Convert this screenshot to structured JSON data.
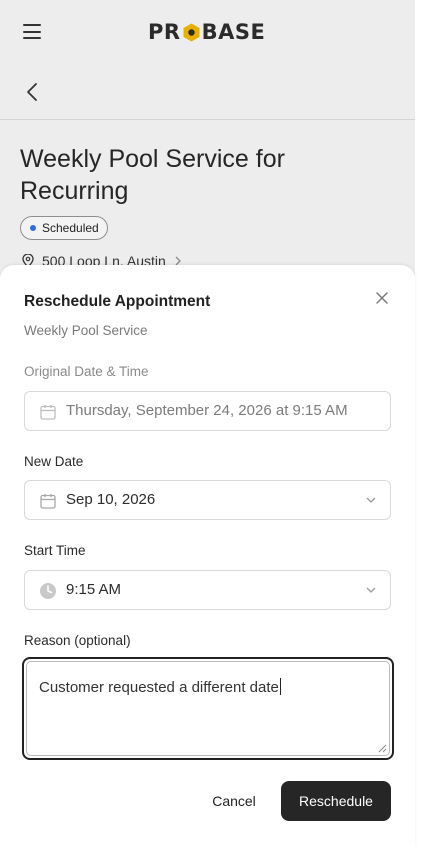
{
  "app": {
    "logo_text_left": "PR",
    "logo_text_right": "BASE"
  },
  "background": {
    "title": "Weekly Pool Service for Recurring",
    "status_badge": "Scheduled",
    "address": "500 Loop Ln, Austin"
  },
  "modal": {
    "title": "Reschedule Appointment",
    "subtitle": "Weekly Pool Service",
    "original": {
      "label": "Original Date & Time",
      "value": "Thursday, September 24, 2026 at 9:15 AM"
    },
    "new_date": {
      "label": "New Date",
      "value": "Sep 10, 2026"
    },
    "start_time": {
      "label": "Start Time",
      "value": "9:15 AM"
    },
    "reason": {
      "label": "Reason (optional)",
      "value": "Customer requested a different date"
    },
    "cancel_label": "Cancel",
    "submit_label": "Reschedule"
  },
  "colors": {
    "brand_dark": "#262626",
    "logo_accent": "#e8b100",
    "status_dot": "#2c6fd6"
  },
  "icons": [
    "menu-icon",
    "chevron-left-icon",
    "location-pin-icon",
    "chevron-right-icon",
    "close-icon",
    "calendar-icon",
    "clock-icon",
    "chevron-down-icon",
    "resize-handle-icon"
  ]
}
